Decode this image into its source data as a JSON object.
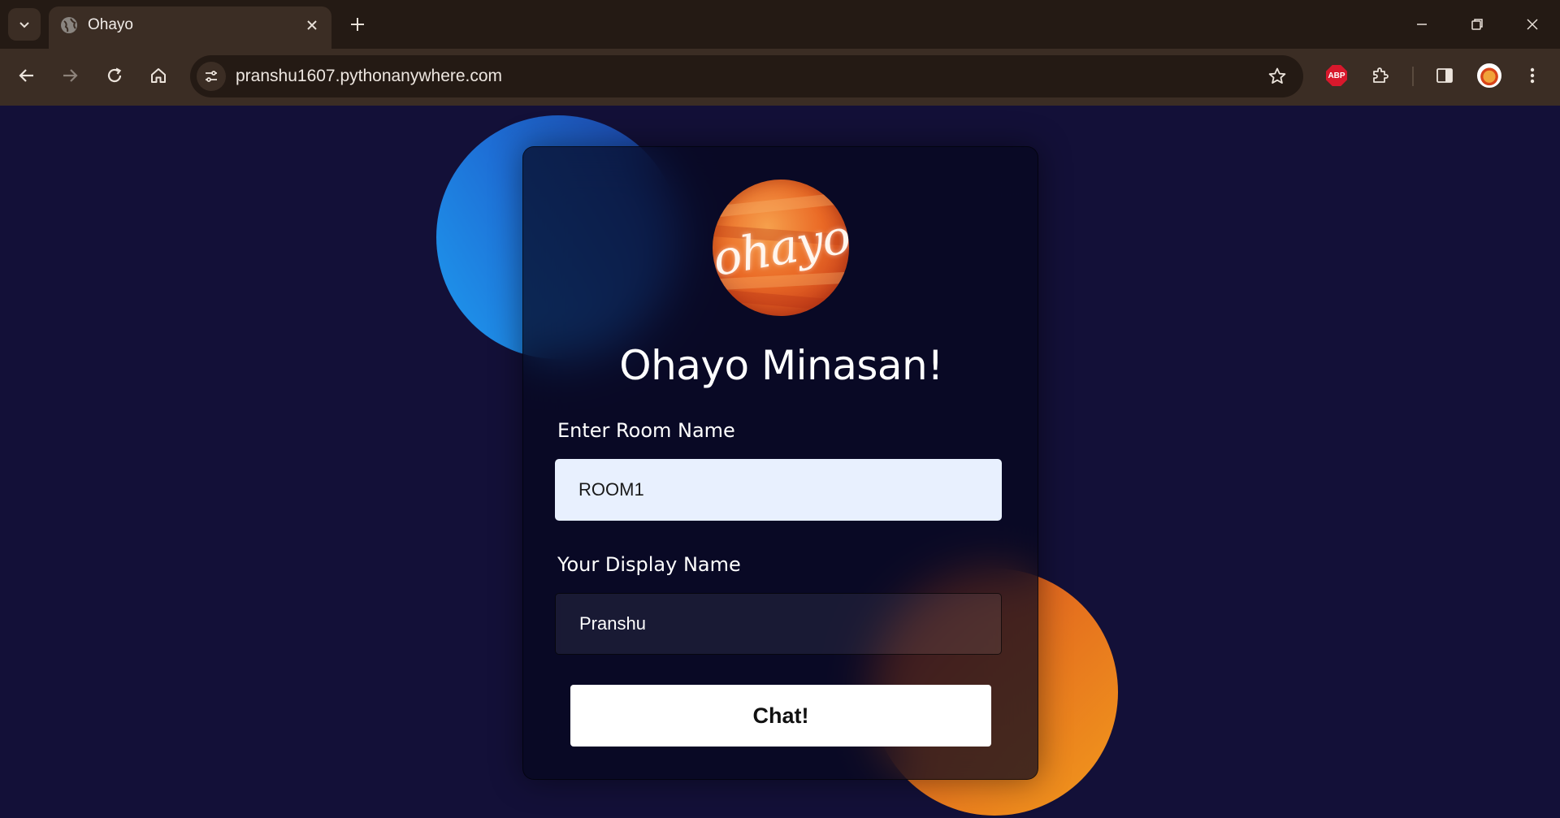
{
  "browser": {
    "tab": {
      "title": "Ohayo"
    },
    "address_bar": {
      "url": "pranshu1607.pythonanywhere.com"
    },
    "extensions": {
      "adblock_label": "ABP"
    }
  },
  "page": {
    "logo": {
      "text": "ohayo"
    },
    "heading": "Ohayo Minasan!",
    "room_field": {
      "label": "Enter Room Name",
      "value": "ROOM1"
    },
    "name_field": {
      "label": "Your Display Name",
      "value": "Pranshu"
    },
    "submit_label": "Chat!"
  },
  "colors": {
    "page_background": "#131038",
    "blob_blue": "#1e7fe0",
    "blob_orange": "#ec7a1e",
    "logo_orange": "#ea6a26"
  }
}
